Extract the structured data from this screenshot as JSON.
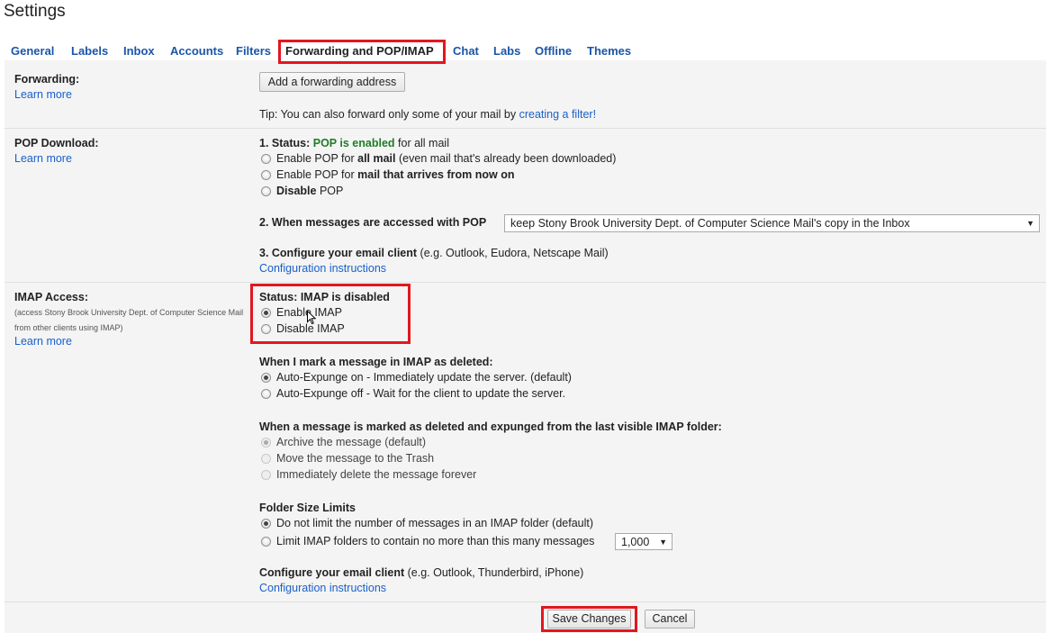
{
  "page_title": "Settings",
  "tabs": [
    "General",
    "Labels",
    "Inbox",
    "Accounts",
    "Filters",
    "Forwarding and POP/IMAP",
    "Chat",
    "Labs",
    "Offline",
    "Themes"
  ],
  "forwarding": {
    "title": "Forwarding:",
    "learn_more": "Learn more",
    "add_button": "Add a forwarding address",
    "tip": "Tip: You can also forward only some of your mail by",
    "tip_link": "creating a filter!"
  },
  "pop": {
    "title": "POP Download:",
    "learn_more": "Learn more",
    "status_label": "1. Status:",
    "status_value": "POP is enabled",
    "status_suffix": "for all mail",
    "options": [
      {
        "pre": "Enable POP for",
        "bold": "all mail",
        "post": "(even mail that's already been downloaded)"
      },
      {
        "pre": "Enable POP for",
        "bold": "mail that arrives from now on",
        "post": ""
      },
      {
        "pre": "",
        "bold": "Disable",
        "post": "POP"
      }
    ],
    "access_label": "2. When messages are accessed with POP",
    "access_select": "keep Stony Brook University Dept. of Computer Science Mail's copy in the Inbox",
    "configure_label": "3. Configure your email client",
    "configure_note": "(e.g. Outlook, Eudora, Netscape Mail)",
    "config_link": "Configuration instructions"
  },
  "imap": {
    "title": "IMAP Access:",
    "desc": "(access Stony Brook University Dept. of Computer Science Mail from other clients using IMAP)",
    "learn_more": "Learn more",
    "status": "Status: IMAP is disabled",
    "enable": "Enable IMAP",
    "disable": "Disable IMAP",
    "deleted_heading": "When I mark a message in IMAP as deleted:",
    "deleted_options": [
      "Auto-Expunge on - Immediately update the server. (default)",
      "Auto-Expunge off - Wait for the client to update the server."
    ],
    "expunged_heading": "When a message is marked as deleted and expunged from the last visible IMAP folder:",
    "expunged_options": [
      "Archive the message (default)",
      "Move the message to the Trash",
      "Immediately delete the message forever"
    ],
    "folder_heading": "Folder Size Limits",
    "folder_options": [
      "Do not limit the number of messages in an IMAP folder (default)",
      "Limit IMAP folders to contain no more than this many messages"
    ],
    "folder_limit": "1,000",
    "configure_label": "Configure your email client",
    "configure_note": "(e.g. Outlook, Thunderbird, iPhone)",
    "config_link": "Configuration instructions"
  },
  "footer": {
    "save": "Save Changes",
    "cancel": "Cancel"
  },
  "colors": {
    "highlight": "#e3161f",
    "link": "#1a5fc9",
    "status_green": "#1f7d28"
  }
}
